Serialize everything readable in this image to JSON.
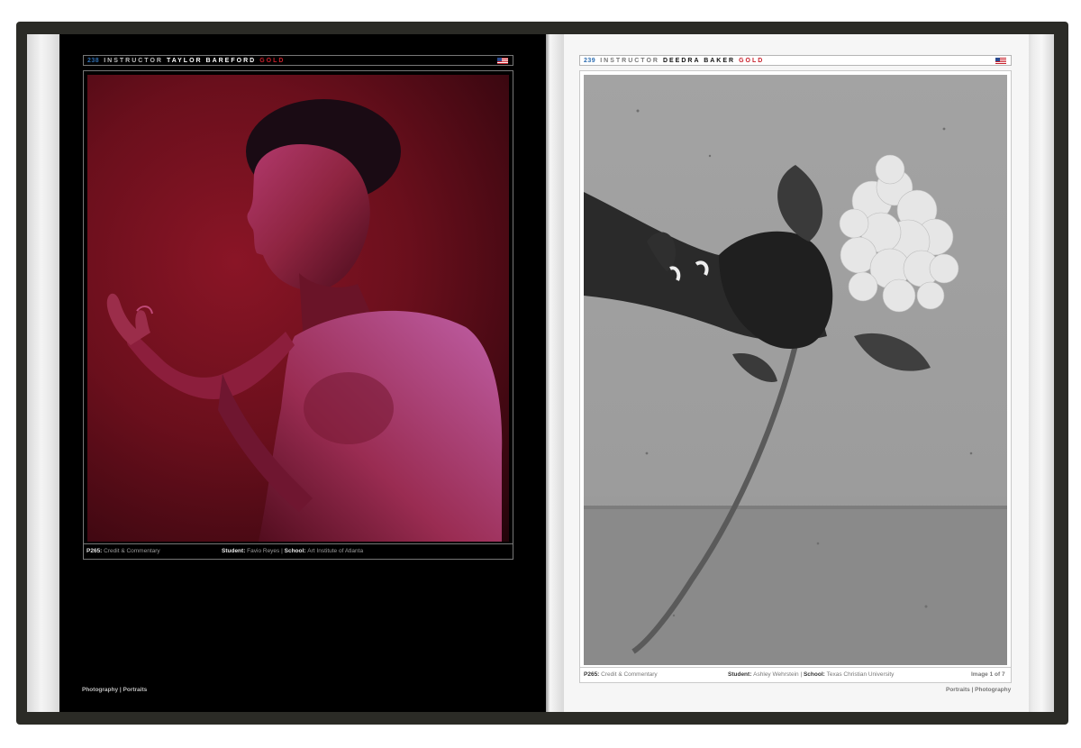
{
  "left_page": {
    "page_number": "238",
    "role": "INSTRUCTOR",
    "instructor": "TAYLOR BAREFORD",
    "award": "GOLD",
    "caption": {
      "ref": "P265:",
      "ref_text": "Credit & Commentary",
      "student_label": "Student:",
      "student": "Favio Reyes",
      "separator": "|",
      "school_label": "School:",
      "school": "Art Institute of Atlanta"
    },
    "footer": "Photography | Portraits"
  },
  "right_page": {
    "page_number": "239",
    "role": "INSTRUCTOR",
    "instructor": "DEEDRA BAKER",
    "award": "GOLD",
    "caption": {
      "ref": "P265:",
      "ref_text": "Credit & Commentary",
      "student_label": "Student:",
      "student": "Ashley Wehrstein",
      "separator": "|",
      "school_label": "School:",
      "school": "Texas Christian University",
      "image_count": "Image 1 of 7"
    },
    "footer": "Portraits | Photography"
  },
  "icons": [
    "us-flag-icon"
  ],
  "colors": {
    "page_number": "#2f6fb2",
    "award": "#c8202b",
    "cover": "#2b2b26"
  }
}
